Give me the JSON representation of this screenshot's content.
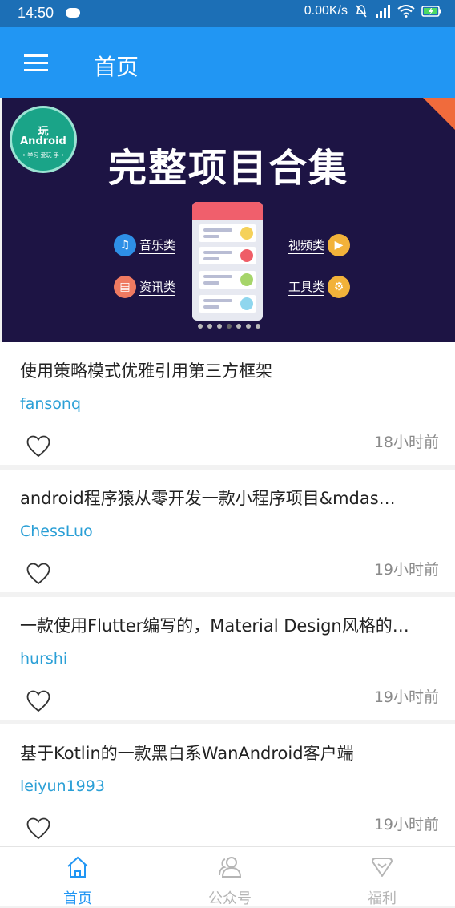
{
  "status_bar": {
    "time": "14:50",
    "speed": "0.00K/s"
  },
  "app_bar": {
    "title": "首页"
  },
  "banner": {
    "badge_top": "玩",
    "badge_main": "Android",
    "badge_sub": "• 学习 爱玩 手 •",
    "title": "完整项目合集",
    "features": [
      "音乐类",
      "资讯类",
      "视频类",
      "工具类"
    ]
  },
  "articles": [
    {
      "title": "使用策略模式优雅引用第三方框架",
      "author": "fansonq",
      "time": "18小时前"
    },
    {
      "title": "android程序猿从零开发一款小程序项目&mdas…",
      "author": "ChessLuo",
      "time": "19小时前"
    },
    {
      "title": "一款使用Flutter编写的，Material Design风格的…",
      "author": "hurshi",
      "time": "19小时前"
    },
    {
      "title": "基于Kotlin的一款黑白系WanAndroid客户端",
      "author": "leiyun1993",
      "time": "19小时前"
    }
  ],
  "bottom_nav": [
    {
      "label": "首页",
      "active": true
    },
    {
      "label": "公众号",
      "active": false
    },
    {
      "label": "福利",
      "active": false
    }
  ],
  "colors": {
    "primary": "#2196f3",
    "status_bar": "#1c6fb6",
    "link": "#2a9fd6"
  }
}
